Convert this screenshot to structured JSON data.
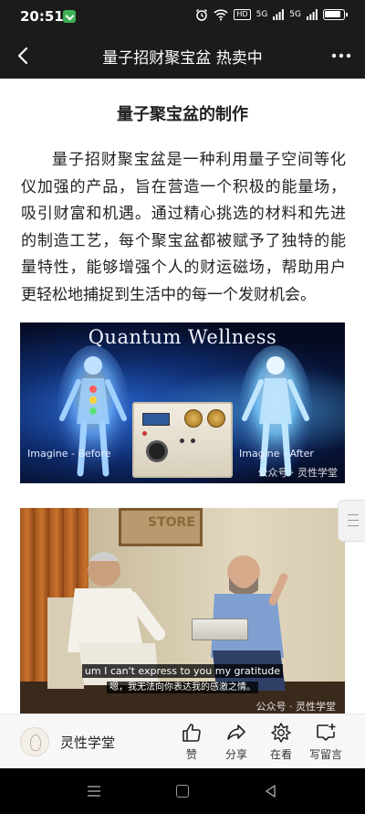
{
  "status_bar": {
    "time": "20:51",
    "hd": "HD",
    "signal1": "5G",
    "signal2": "5G"
  },
  "nav": {
    "title": "量子招财聚宝盆 热卖中",
    "back_icon": "back-arrow-icon",
    "more_icon": "more-dots-icon"
  },
  "article": {
    "heading": "量子聚宝盆的制作",
    "paragraph": "量子招财聚宝盆是一种利用量子空间等化仪加强的产品，旨在营造一个积极的能量场，吸引财富和机遇。通过精心挑选的材料和先进的制造工艺，每个聚宝盆都被赋予了独特的能量特性，能够增强个人的财运磁场，帮助用户更轻松地捕捉到生活中的每一个发财机会。"
  },
  "image1": {
    "title": "Quantum Wellness",
    "label_left": "Imagine - Before",
    "label_right": "Imagine - After",
    "watermark": "公众号 · 灵性学堂"
  },
  "image2": {
    "subtitle_en": "um I can't express to you my gratitude",
    "subtitle_zh": "嗯，我无法向你表达我的感激之情。",
    "watermark": "公众号 · 灵性学堂",
    "sign_text": "STORE"
  },
  "action_bar": {
    "account_name": "灵性学堂",
    "like_label": "赞",
    "share_label": "分享",
    "watching_label": "在看",
    "comment_label": "写留言"
  },
  "colors": {
    "bar_bg": "#1b1b1b",
    "content_bg": "#ffffff",
    "action_bg": "#f7f7f7"
  }
}
